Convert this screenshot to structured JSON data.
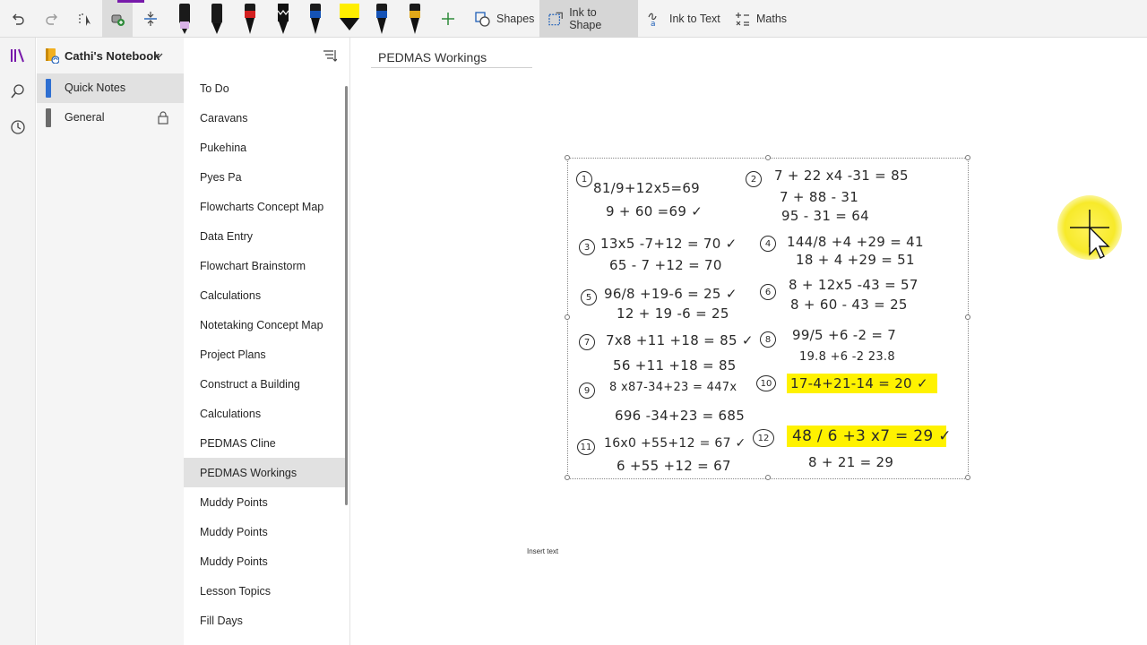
{
  "ribbon": {
    "shapes_label": "Shapes",
    "ink_to_shape_label": "Ink to Shape",
    "ink_to_text_label": "Ink to Text",
    "maths_label": "Maths",
    "pen_colors": [
      "#d9b3e8",
      "#111111",
      "#d32020",
      "#111111",
      "#1553b6",
      "#ffee00",
      "#1553b6",
      "#e0a81a"
    ]
  },
  "notebook": {
    "name": "Cathi's Notebook",
    "sections": [
      {
        "label": "Quick Notes",
        "color": "#2e6fd1",
        "selected": true
      },
      {
        "label": "General",
        "color": "#6b6b6b",
        "selected": false,
        "locked": true
      }
    ]
  },
  "pages": [
    {
      "label": "To Do"
    },
    {
      "label": "Caravans"
    },
    {
      "label": "Pukehina"
    },
    {
      "label": "Pyes Pa"
    },
    {
      "label": "Flowcharts Concept Map"
    },
    {
      "label": "Data Entry"
    },
    {
      "label": "Flowchart Brainstorm"
    },
    {
      "label": "Calculations"
    },
    {
      "label": "Notetaking Concept Map"
    },
    {
      "label": "Project Plans"
    },
    {
      "label": "Construct a Building"
    },
    {
      "label": "Calculations"
    },
    {
      "label": "PEDMAS Cline"
    },
    {
      "label": "PEDMAS Workings",
      "selected": true
    },
    {
      "label": "Muddy Points"
    },
    {
      "label": "Muddy Points"
    },
    {
      "label": "Muddy Points"
    },
    {
      "label": "Lesson Topics"
    },
    {
      "label": "Fill Days"
    }
  ],
  "canvas": {
    "page_title": "PEDMAS Workings",
    "insert_text": "Insert text",
    "ink": {
      "numbers": [
        "1",
        "2",
        "3",
        "4",
        "5",
        "6",
        "7",
        "8",
        "9",
        "10",
        "11",
        "12"
      ],
      "lines": [
        "81/9+12x5=69",
        "9 + 60 =69 ✓",
        "7 + 22 x4 -31 = 85",
        "7 + 88 - 31",
        "95 - 31 = 64",
        "13x5 -7+12 = 70 ✓",
        "65 - 7 +12 = 70",
        "144/8 +4 +29 = 41",
        "18 + 4 +29 = 51",
        "96/8 +19-6 = 25 ✓",
        "12 + 19 -6 = 25",
        "8 + 12x5 -43 = 57",
        "8 + 60 - 43 = 25",
        "7x8 +11 +18 = 85 ✓",
        "56 +11 +18 = 85",
        "99/5 +6 -2 = 7",
        "19.8 +6 -2 23.8",
        "8 x87-34+23 = 447x",
        "696 -34+23 = 685",
        "17-4+21-14 = 20 ✓",
        "16x0 +55+12 = 67 ✓",
        "6 +55 +12 = 67",
        "48 / 6 +3 x7 = 29 ✓",
        "8 + 21 = 29"
      ]
    }
  }
}
